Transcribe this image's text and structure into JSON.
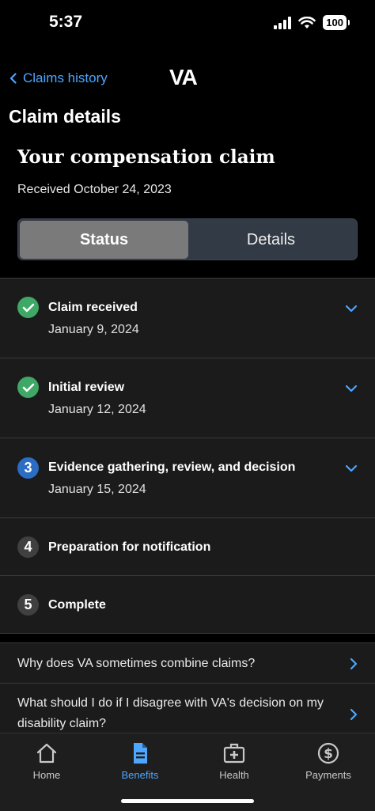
{
  "status_bar": {
    "time": "5:37",
    "battery": "100"
  },
  "nav": {
    "back_label": "Claims history",
    "logo": "VA"
  },
  "page": {
    "title": "Claim details",
    "claim_title": "Your compensation claim",
    "received": "Received October 24, 2023"
  },
  "segmented": {
    "status_label": "Status",
    "details_label": "Details",
    "selected": "Status"
  },
  "steps": [
    {
      "number": "1",
      "title": "Claim received",
      "date": "January 9, 2024",
      "state": "done"
    },
    {
      "number": "2",
      "title": "Initial review",
      "date": "January 12, 2024",
      "state": "done"
    },
    {
      "number": "3",
      "title": "Evidence gathering, review, and decision",
      "date": "January 15, 2024",
      "state": "current"
    },
    {
      "number": "4",
      "title": "Preparation for notification",
      "date": "",
      "state": "future"
    },
    {
      "number": "5",
      "title": "Complete",
      "date": "",
      "state": "future"
    }
  ],
  "faq": [
    {
      "question": "Why does VA sometimes combine claims?"
    },
    {
      "question": "What should I do if I disagree with VA's decision on my disability claim?"
    }
  ],
  "tabbar": {
    "home": "Home",
    "benefits": "Benefits",
    "health": "Health",
    "payments": "Payments",
    "active": "Benefits"
  },
  "colors": {
    "accent": "#4da6ff",
    "complete": "#3fa866",
    "current": "#2b6cc4",
    "background": "#000000",
    "card": "#1b1b1b"
  }
}
